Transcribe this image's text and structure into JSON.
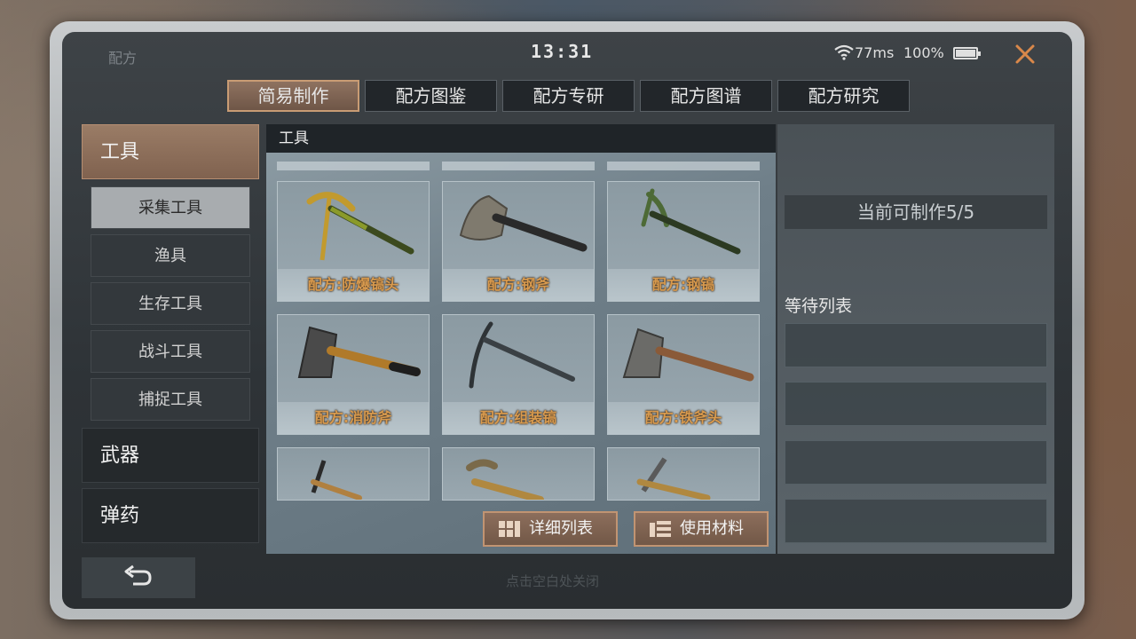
{
  "status_bar": {
    "app_title": "配方",
    "time": "13:31",
    "ping": "77ms",
    "battery": "100%"
  },
  "tabs": [
    {
      "label": "简易制作",
      "active": true
    },
    {
      "label": "配方图鉴",
      "active": false
    },
    {
      "label": "配方专研",
      "active": false
    },
    {
      "label": "配方图谱",
      "active": false
    },
    {
      "label": "配方研究",
      "active": false
    }
  ],
  "sidebar": {
    "categories": [
      {
        "label": "工具",
        "active": true
      },
      {
        "label": "武器",
        "active": false
      },
      {
        "label": "弹药",
        "active": false
      }
    ],
    "subcategories": [
      {
        "label": "采集工具",
        "active": true
      },
      {
        "label": "渔具",
        "active": false
      },
      {
        "label": "生存工具",
        "active": false
      },
      {
        "label": "战斗工具",
        "active": false
      },
      {
        "label": "捕捉工具",
        "active": false
      }
    ]
  },
  "main": {
    "header": "工具",
    "recipes": [
      {
        "label": "配方:防爆镐头",
        "icon": "pickaxe-icon"
      },
      {
        "label": "配方:钢斧",
        "icon": "axe-icon"
      },
      {
        "label": "配方:钢镐",
        "icon": "pickaxe-icon"
      },
      {
        "label": "配方:消防斧",
        "icon": "axe-icon"
      },
      {
        "label": "配方:组装镐",
        "icon": "pickaxe-icon"
      },
      {
        "label": "配方:铁斧头",
        "icon": "axe-icon"
      }
    ],
    "detail_button": "详细列表",
    "materials_button": "使用材料"
  },
  "right": {
    "craftable": "当前可制作5/5",
    "queue_title": "等待列表"
  },
  "footer": {
    "hint": "点击空白处关闭"
  },
  "colors": {
    "accent": "#c99c74",
    "recipe_label": "#d89a4e",
    "close": "#d9884a"
  }
}
